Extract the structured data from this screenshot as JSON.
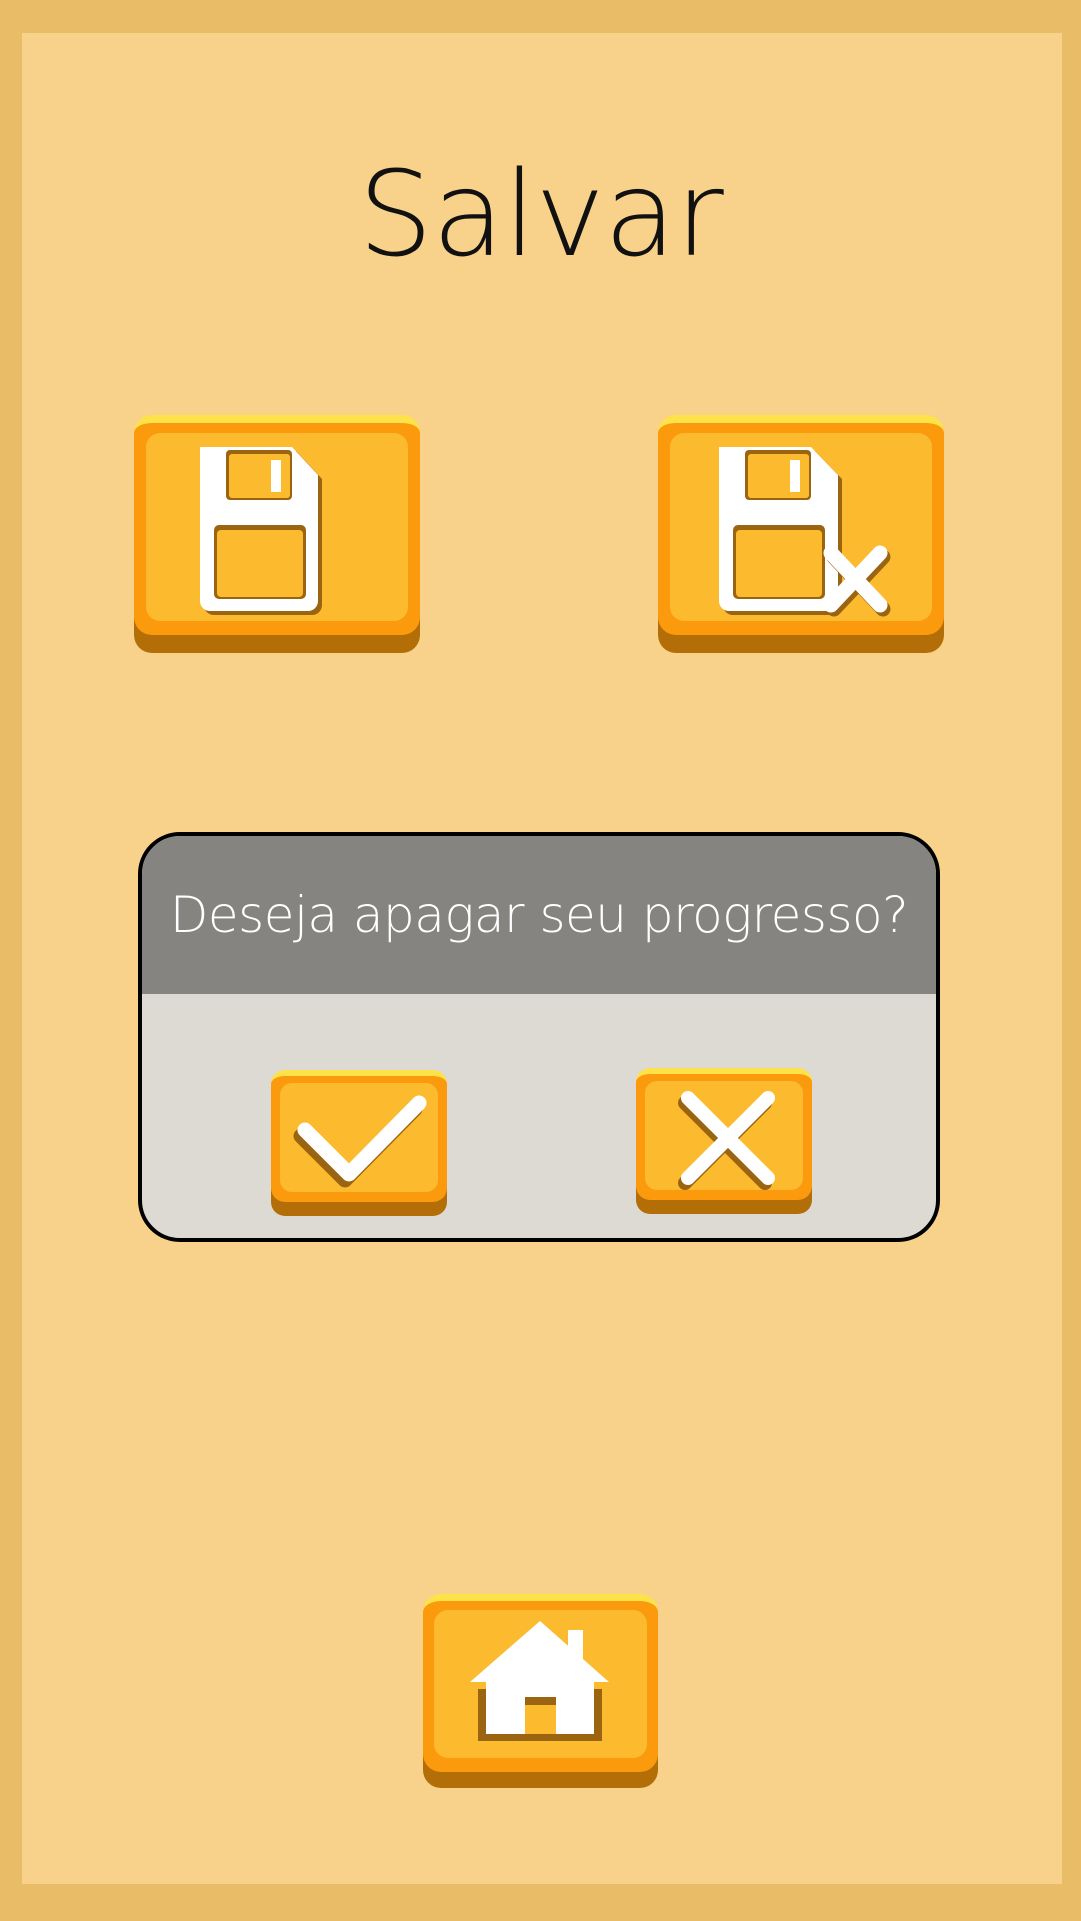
{
  "screen": {
    "title": "Salvar"
  },
  "buttons": {
    "save_icon": "floppy-disk-icon",
    "delete_save_icon": "floppy-disk-delete-icon",
    "home_icon": "home-icon"
  },
  "dialog": {
    "question": "Deseja apagar seu progresso?",
    "confirm_icon": "checkmark-icon",
    "cancel_icon": "close-icon"
  },
  "colors": {
    "outer_frame": "#e9bd68",
    "panel": "#f8d28a",
    "button_face": "#fcba2e",
    "button_rim": "#fb9a0c",
    "button_highlight": "#fde24a",
    "button_shadow": "#b36e07",
    "dialog_header": "#858480",
    "dialog_body": "#dcdad2"
  }
}
